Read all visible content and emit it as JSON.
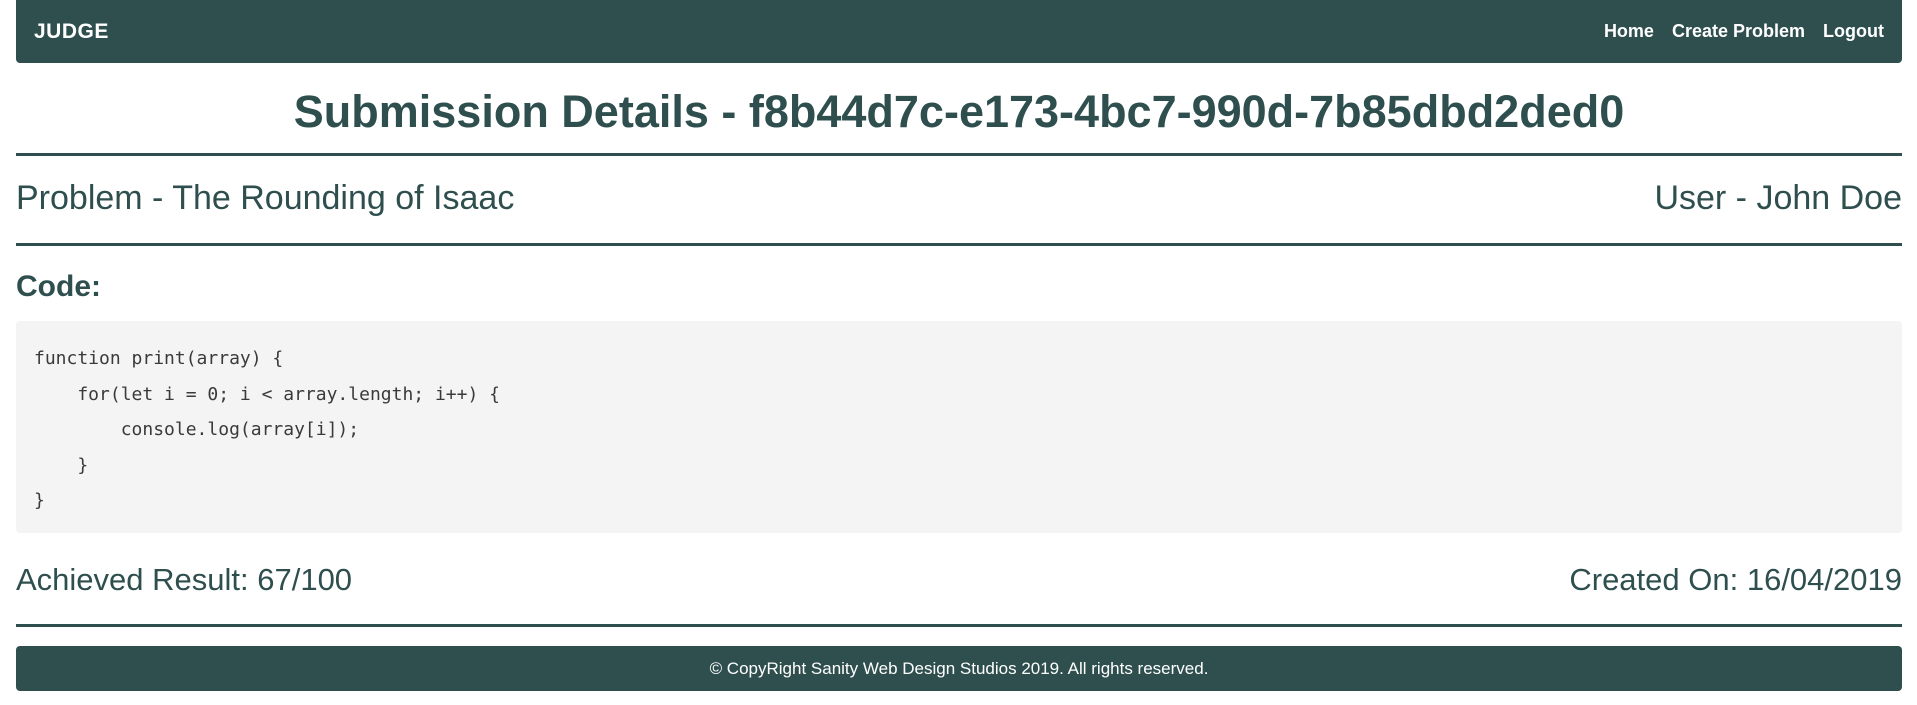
{
  "navbar": {
    "brand": "JUDGE",
    "links": [
      "Home",
      "Create Problem",
      "Logout"
    ]
  },
  "page": {
    "title": "Submission Details - f8b44d7c-e173-4bc7-990d-7b85dbd2ded0",
    "problem": "Problem - The Rounding of Isaac",
    "user": "User - John Doe",
    "code_heading": "Code:",
    "code_lines": [
      "function print(array) {",
      "    for(let i = 0; i < array.length; i++) {",
      "        console.log(array[i]);",
      "    }",
      "}"
    ],
    "result": "Achieved Result: 67/100",
    "created_on": "Created On: 16/04/2019"
  },
  "footer": {
    "text": "© CopyRight Sanity Web Design Studios 2019. All rights reserved."
  },
  "colors": {
    "primary": "#2f4f4f",
    "code_background": "#f4f4f4"
  }
}
